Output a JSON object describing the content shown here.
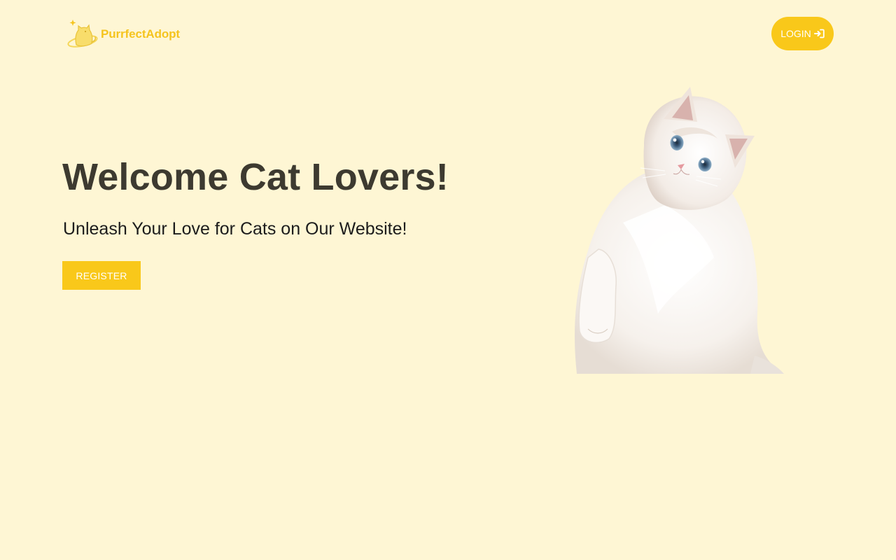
{
  "header": {
    "brand_name": "PurrfectAdopt",
    "login_label": "LOGIN"
  },
  "hero": {
    "title": "Welcome Cat Lovers!",
    "subtitle": "Unleash Your Love for Cats on Our Website!",
    "register_label": "REGISTER"
  },
  "icons": {
    "logo": "cat-logo-icon",
    "login": "sign-in-icon",
    "hero_image": "white-cat-photo"
  },
  "colors": {
    "background": "#fef6d4",
    "accent": "#f9c81a",
    "heading": "#3d3a30",
    "text": "#1c1c1c",
    "button_text": "#ffffff"
  }
}
